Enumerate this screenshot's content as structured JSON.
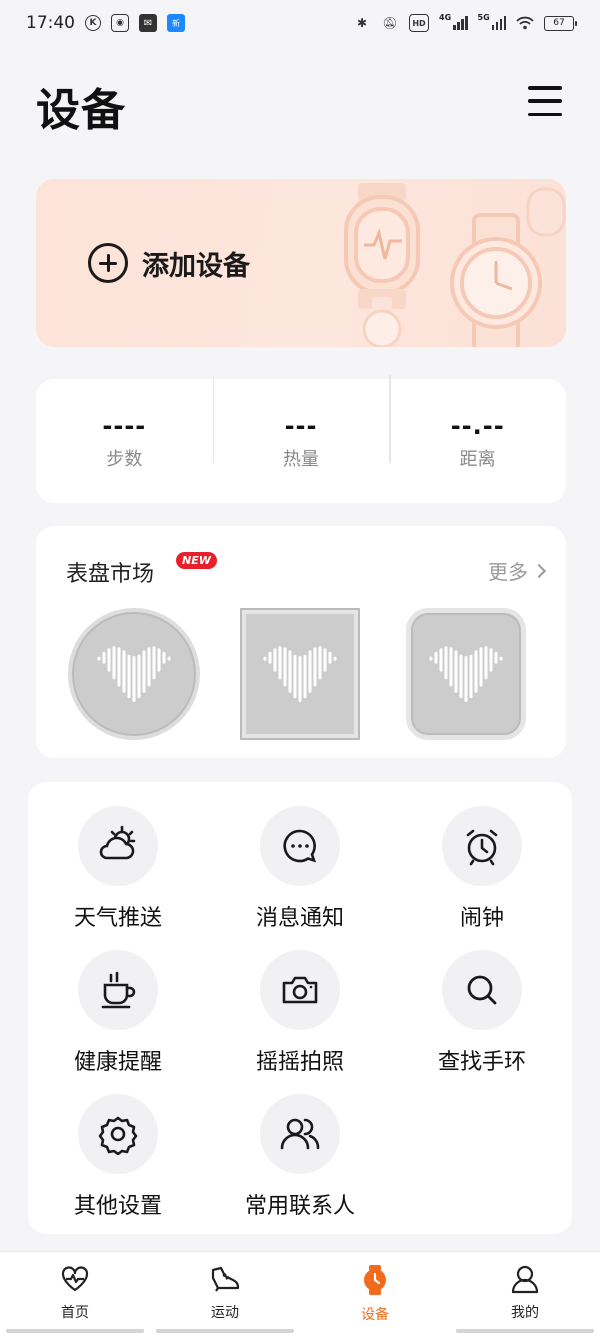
{
  "status_bar": {
    "time": "17:40",
    "left_icons": [
      "k-circle-icon",
      "screen-record-icon",
      "mail-icon",
      "app-badge-icon"
    ],
    "app_badge_text": "新",
    "hd_label": "HD",
    "signal1_label": "4G",
    "signal2_label": "5G",
    "battery_level": "67"
  },
  "header": {
    "title": "设备"
  },
  "add_device": {
    "label": "添加设备"
  },
  "stats": [
    {
      "value": "----",
      "label": "步数"
    },
    {
      "value": "---",
      "label": "热量"
    },
    {
      "value": "--.--",
      "label": "距离"
    }
  ],
  "watch_faces": {
    "title": "表盘市场",
    "badge": "NEW",
    "more_label": "更多"
  },
  "features": [
    {
      "label": "天气推送",
      "icon": "weather-icon"
    },
    {
      "label": "消息通知",
      "icon": "message-icon"
    },
    {
      "label": "闹钟",
      "icon": "alarm-icon"
    },
    {
      "label": "健康提醒",
      "icon": "coffee-cup-icon"
    },
    {
      "label": "摇摇拍照",
      "icon": "camera-icon"
    },
    {
      "label": "查找手环",
      "icon": "search-icon"
    },
    {
      "label": "其他设置",
      "icon": "gear-icon"
    },
    {
      "label": "常用联系人",
      "icon": "contacts-icon"
    }
  ],
  "bottom_nav": [
    {
      "label": "首页",
      "icon": "heart-pulse-icon"
    },
    {
      "label": "运动",
      "icon": "shoe-icon"
    },
    {
      "label": "设备",
      "icon": "watch-icon",
      "active": true
    },
    {
      "label": "我的",
      "icon": "person-icon"
    }
  ],
  "colors": {
    "accent": "#f26b1d",
    "card_bg": "#ffffff",
    "page_bg": "#f5f5f7",
    "add_card_bg": "#fde3d8",
    "new_badge": "#e8202a"
  }
}
